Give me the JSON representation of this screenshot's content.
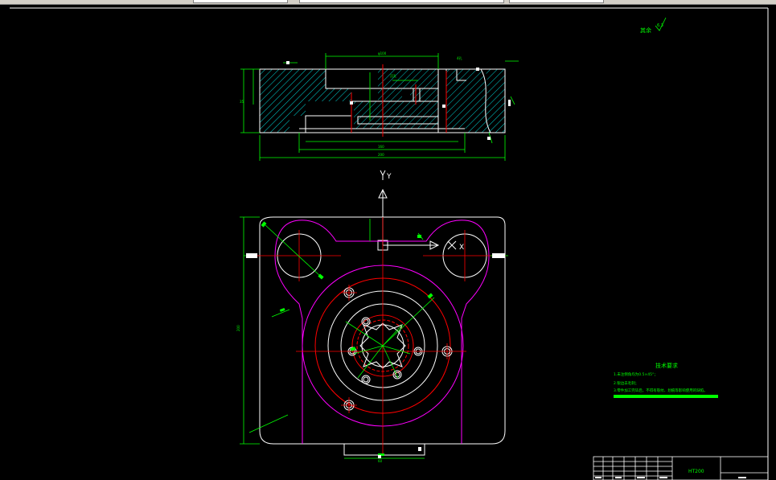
{
  "toolbar": {
    "layer_value": "",
    "linetype_value": "",
    "lineweight_value": ""
  },
  "drawing": {
    "axis_y_label": "Y",
    "axis_x_label": "X",
    "corner_note": "其余",
    "corner_roughness": "6.3",
    "tech_requirements": {
      "title": "技术要求",
      "items": [
        "1.未注倒角均为0.5×45°；",
        "2.锐边去毛刺；",
        "3.零件加工完毕后，不得有裂纹、划痕等影响使用的缺陷。"
      ]
    },
    "title_block": {
      "material": "HT200"
    }
  },
  "colors": {
    "background": "#000000",
    "outline": "#ffffff",
    "dimension": "#00ff00",
    "centerline": "#ff0000",
    "boundary": "#ff00ff",
    "hatch": "#00ffff",
    "text_highlight": "#00ff00"
  }
}
